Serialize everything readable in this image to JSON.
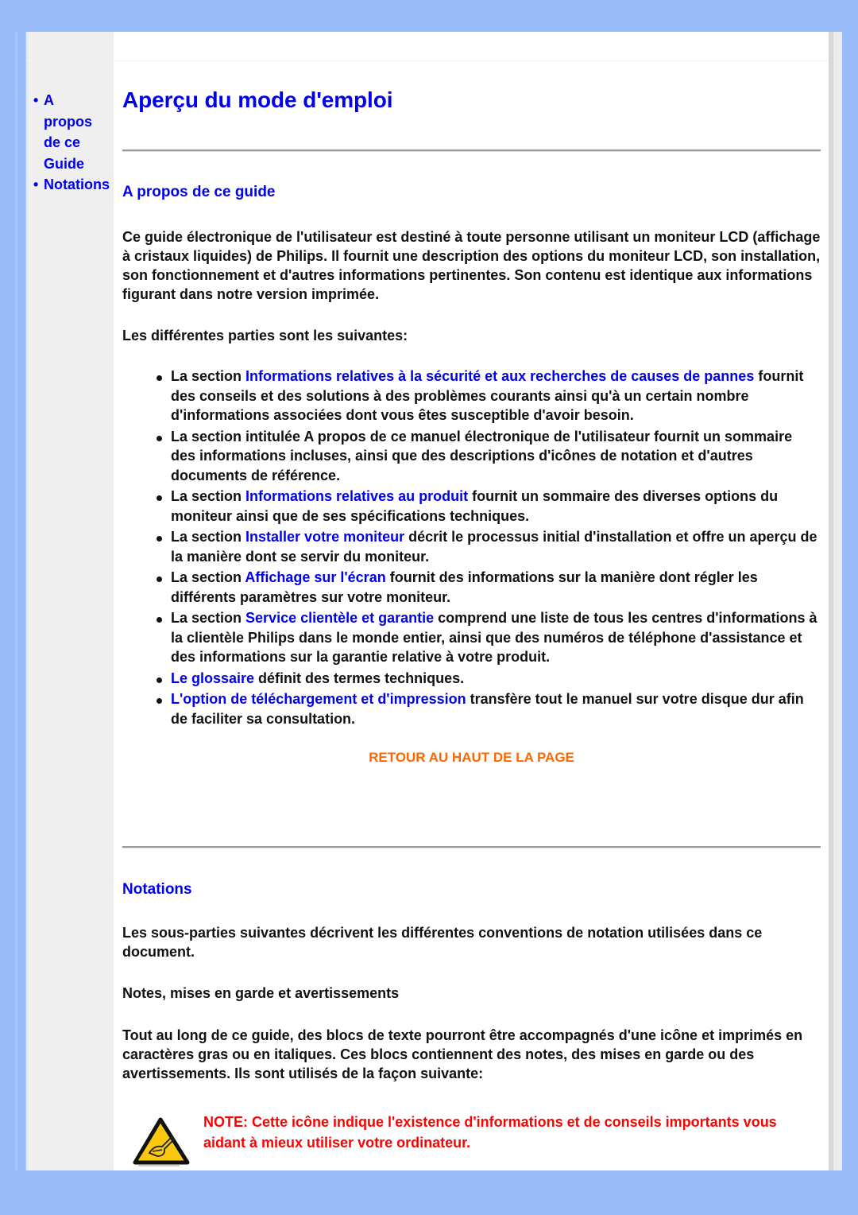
{
  "sidebar": {
    "items": [
      {
        "label": "A propos de ce Guide"
      },
      {
        "label": "Notations"
      }
    ]
  },
  "page_title": "Aperçu du mode d'emploi",
  "section_about": {
    "heading": "A propos de ce guide",
    "intro": "Ce guide électronique de l'utilisateur est destiné à toute personne utilisant un moniteur LCD (affichage à cristaux liquides) de Philips. Il fournit une description des options du moniteur LCD, son installation, son fonctionnement et d'autres informations pertinentes. Son contenu est identique aux informations figurant dans notre version imprimée.",
    "parts_intro": "Les différentes parties sont les suivantes:",
    "items": [
      {
        "prefix": "La section ",
        "link": "Informations relatives à la sécurité et aux recherches de causes de pannes",
        "suffix": " fournit des conseils et des solutions à des problèmes courants ainsi qu'à un certain nombre d'informations associées dont vous êtes susceptible d'avoir besoin."
      },
      {
        "prefix": "La section intitulée A propos de ce manuel électronique de l'utilisateur fournit un sommaire des informations incluses, ainsi que des descriptions d'icônes de notation et d'autres documents de référence.",
        "link": "",
        "suffix": ""
      },
      {
        "prefix": "La section ",
        "link": "Informations relatives au produit",
        "suffix": " fournit un sommaire des diverses options du moniteur ainsi que de ses spécifications techniques."
      },
      {
        "prefix": "La section ",
        "link": "Installer votre moniteur",
        "suffix": " décrit le processus initial d'installation et offre un aperçu de la manière dont se servir du moniteur."
      },
      {
        "prefix": "La section ",
        "link": "Affichage sur l'écran",
        "suffix": " fournit des informations sur la manière dont régler les différents paramètres sur votre moniteur."
      },
      {
        "prefix": "La section ",
        "link": "Service clientèle et garantie",
        "suffix": " comprend une liste de tous les centres d'informations à la clientèle Philips dans le monde entier, ainsi que des numéros de téléphone d'assistance et des informations sur la garantie relative à votre produit."
      },
      {
        "prefix": "",
        "link": "Le glossaire",
        "suffix": " définit des termes techniques."
      },
      {
        "prefix": "",
        "link": "L'option de téléchargement et d'impression",
        "suffix": " transfère tout le manuel sur votre disque dur afin de faciliter sa consultation."
      }
    ],
    "back_to_top": "RETOUR AU HAUT DE LA PAGE"
  },
  "section_notations": {
    "heading": "Notations",
    "intro": "Les sous-parties suivantes décrivent les différentes conventions de notation utilisées dans ce document.",
    "subheading": "Notes, mises en garde et avertissements",
    "body": "Tout au long de ce guide, des blocs de texte pourront être accompagnés d'une icône et imprimés en caractères gras ou en italiques. Ces blocs contiennent des notes, des mises en garde ou des avertissements. Ils sont utilisés de la façon suivante:",
    "note": {
      "icon": "note-pencil-warning-icon",
      "text": "NOTE: Cette icône indique l'existence d'informations et de conseils importants vous aidant à mieux utiliser votre ordinateur."
    }
  },
  "colors": {
    "background": "#99bbf7",
    "link": "#0000ee",
    "back_to_top": "#ff6600",
    "note": "#ff0000"
  }
}
